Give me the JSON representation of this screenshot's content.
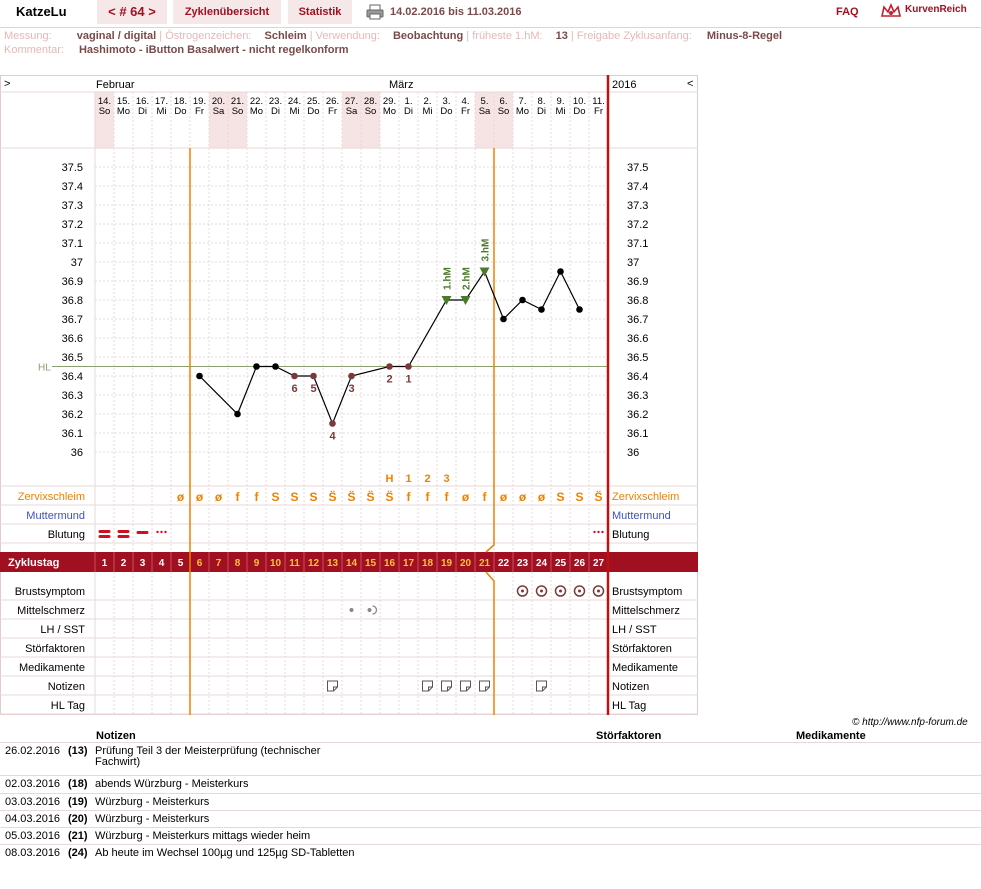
{
  "header": {
    "user": "KatzeLu",
    "cycle_nav": "< # 64 >",
    "tab_overview": "Zyklenübersicht",
    "tab_stats": "Statistik",
    "date_range": "14.02.2016 bis 11.03.2016",
    "faq": "FAQ",
    "logo_text": "KurvenReich"
  },
  "info": {
    "messung_k": "Messung:",
    "messung_v": "vaginal / digital",
    "oestro_k": "Östrogenzeichen:",
    "oestro_v": "Schleim",
    "verw_k": "Verwendung:",
    "verw_v": "Beobachtung",
    "fhm_k": "früheste 1.hM:",
    "fhm_v": "13",
    "freigabe_k": "Freigabe Zyklusanfang:",
    "freigabe_v": "Minus-8-Regel",
    "komm_k": "Kommentar:",
    "komm_v": "Hashimoto - iButton Basalwert - nicht regelkonform",
    "sep": "|"
  },
  "chart_data": {
    "type": "line",
    "year": "2016",
    "nav_left": ">",
    "nav_right": "<",
    "months": [
      {
        "label": "Februar",
        "start": 0
      },
      {
        "label": "März",
        "start": 16
      }
    ],
    "days": [
      "14.",
      "15.",
      "16.",
      "17.",
      "18.",
      "19.",
      "20.",
      "21.",
      "22.",
      "23.",
      "24.",
      "25.",
      "26.",
      "27.",
      "28.",
      "29.",
      "1.",
      "2.",
      "3.",
      "4.",
      "5.",
      "6.",
      "7.",
      "8.",
      "9.",
      "10.",
      "11."
    ],
    "weekdays": [
      "So",
      "Mo",
      "Di",
      "Mi",
      "Do",
      "Fr",
      "Sa",
      "So",
      "Mo",
      "Di",
      "Mi",
      "Do",
      "Fr",
      "Sa",
      "So",
      "Mo",
      "Di",
      "Mi",
      "Do",
      "Fr",
      "Sa",
      "So",
      "Mo",
      "Di",
      "Mi",
      "Do",
      "Fr"
    ],
    "shaded_days": [
      0,
      6,
      7,
      13,
      14,
      20,
      21
    ],
    "y_ticks": [
      "37.5",
      "37.4",
      "37.3",
      "37.2",
      "37.1",
      "37",
      "36.9",
      "36.8",
      "36.7",
      "36.6",
      "36.5",
      "36.4",
      "36.3",
      "36.2",
      "36.1",
      "36"
    ],
    "ylim": [
      36.0,
      37.5
    ],
    "temps": [
      null,
      null,
      null,
      null,
      null,
      36.4,
      null,
      36.2,
      36.45,
      36.45,
      36.4,
      36.4,
      36.15,
      36.4,
      null,
      36.45,
      36.45,
      null,
      36.8,
      36.8,
      36.95,
      36.7,
      36.8,
      36.75,
      36.95,
      36.75,
      null
    ],
    "disturbed_points": [
      10,
      11,
      12,
      13,
      15,
      16
    ],
    "point_labels": [
      {
        "i": 10,
        "t": "6",
        "pos": "below"
      },
      {
        "i": 11,
        "t": "5",
        "pos": "below"
      },
      {
        "i": 12,
        "t": "4",
        "pos": "below"
      },
      {
        "i": 13,
        "t": "3",
        "pos": "below"
      },
      {
        "i": 15,
        "t": "2",
        "pos": "below"
      },
      {
        "i": 16,
        "t": "1",
        "pos": "below"
      }
    ],
    "high_marks": [
      {
        "i": 18,
        "t": "1.hM"
      },
      {
        "i": 19,
        "t": "2.hM"
      },
      {
        "i": 20,
        "t": "3.hM"
      }
    ],
    "hl_value": 36.45,
    "hl_label": "HL",
    "cover_line_days": [
      5,
      21
    ],
    "h_labels": [
      {
        "i": 15,
        "t": "H"
      },
      {
        "i": 16,
        "t": "1"
      },
      {
        "i": 17,
        "t": "2"
      },
      {
        "i": 18,
        "t": "3"
      }
    ],
    "rows": {
      "zervix": "Zervixschleim",
      "muttermund": "Muttermund",
      "blutung": "Blutung",
      "zyklustag": "Zyklustag",
      "brust": "Brustsymptom",
      "mittel": "Mittelschmerz",
      "lh": "LH / SST",
      "stoer": "Störfaktoren",
      "medi": "Medikamente",
      "notizen": "Notizen",
      "hltag": "HL Tag"
    },
    "zervix": [
      "",
      "",
      "",
      "",
      "ø",
      "ø",
      "ø",
      "f",
      "f",
      "S",
      "S",
      "S",
      "S̈",
      "S̈",
      "S̈",
      "S̈",
      "f",
      "f",
      "f",
      "ø",
      "f",
      "ø",
      "ø",
      "ø",
      "S",
      "S",
      "S̈"
    ],
    "zervix_plus": [
      12,
      13,
      14,
      15,
      26
    ],
    "blutung": [
      "stark",
      "stark",
      "mittel",
      "schwach",
      "",
      "",
      "",
      "",
      "",
      "",
      "",
      "",
      "",
      "",
      "",
      "",
      "",
      "",
      "",
      "",
      "",
      "",
      "",
      "",
      "",
      "",
      "schwach"
    ],
    "cycle_days": [
      "1",
      "2",
      "3",
      "4",
      "5",
      "6",
      "7",
      "8",
      "9",
      "10",
      "11",
      "12",
      "13",
      "14",
      "15",
      "16",
      "17",
      "18",
      "19",
      "20",
      "21",
      "22",
      "23",
      "24",
      "25",
      "26",
      "27"
    ],
    "brust_days": [
      22,
      23,
      24,
      25,
      26
    ],
    "mittel_days": [
      13,
      14
    ],
    "notiz_days": [
      12,
      17,
      18,
      19,
      20,
      23
    ],
    "copyright": "© http://www.nfp-forum.de"
  },
  "notes": {
    "h_notizen": "Notizen",
    "h_stoer": "Störfaktoren",
    "h_medi": "Medikamente",
    "rows": [
      {
        "date": "26.02.2016",
        "day": "(13)",
        "text": "Prüfung Teil 3 der Meisterprüfung (technischer",
        "text2": "Fachwirt)"
      },
      {
        "date": "02.03.2016",
        "day": "(18)",
        "text": "abends Würzburg - Meisterkurs",
        "text2": ""
      },
      {
        "date": "03.03.2016",
        "day": "(19)",
        "text": "Würzburg - Meisterkurs",
        "text2": ""
      },
      {
        "date": "04.03.2016",
        "day": "(20)",
        "text": "Würzburg - Meisterkurs",
        "text2": ""
      },
      {
        "date": "05.03.2016",
        "day": "(21)",
        "text": "Würzburg - Meisterkurs mittags wieder heim",
        "text2": ""
      },
      {
        "date": "08.03.2016",
        "day": "(24)",
        "text": "Ab heute im Wechsel 100µg und 125µg SD-Tabletten",
        "text2": ""
      }
    ]
  },
  "colors": {
    "accent": "#a01020",
    "orange": "#f08000",
    "grid": "#e8d8d8",
    "shade": "#f6e4e4",
    "hl": "#8aa070",
    "green": "#4a7a2a",
    "point": "#7a3a3a"
  }
}
